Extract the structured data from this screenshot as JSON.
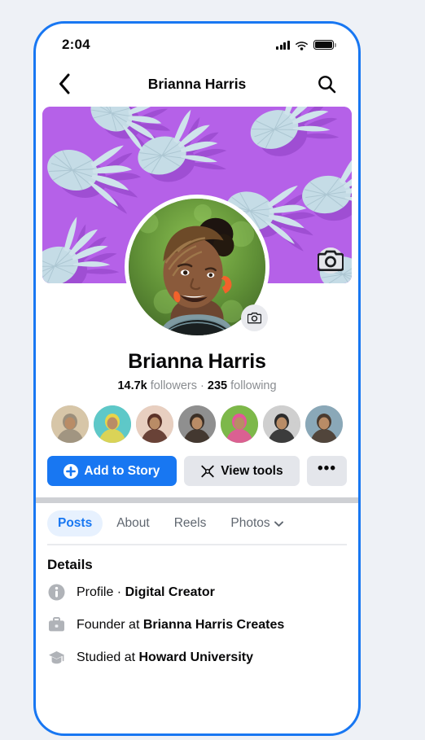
{
  "status_bar": {
    "time": "2:04",
    "icons": [
      "cellular-signal-icon",
      "wifi-icon",
      "battery-icon"
    ]
  },
  "nav": {
    "back_icon": "chevron-left-icon",
    "title": "Brianna Harris",
    "search_icon": "search-icon"
  },
  "cover": {
    "description": "purple background with light blue pineapples",
    "bg_color": "#b561e8",
    "pineapple_color": "#c5dce6",
    "camera_button_label": "camera-icon"
  },
  "profile_picture": {
    "description": "smiling woman with braided updo hair and orange earrings outdoors",
    "camera_button_label": "camera-icon"
  },
  "identity": {
    "name": "Brianna Harris",
    "followers_count": "14.7k",
    "followers_label": "followers",
    "separator": "·",
    "following_count": "235",
    "following_label": "following"
  },
  "friends": [
    {
      "name": "friend-avatar-1",
      "color_a": "#d7c6a8",
      "color_b": "#9b8f7c"
    },
    {
      "name": "friend-avatar-2",
      "color_a": "#5ec8c8",
      "color_b": "#e8d44a"
    },
    {
      "name": "friend-avatar-3",
      "color_a": "#e8cfc0",
      "color_b": "#5b3228"
    },
    {
      "name": "friend-avatar-4",
      "color_a": "#8f8f8f",
      "color_b": "#3b2f26"
    },
    {
      "name": "friend-avatar-5",
      "color_a": "#7db84a",
      "color_b": "#e5569a"
    },
    {
      "name": "friend-avatar-6",
      "color_a": "#cfcfcf",
      "color_b": "#2b2b2b"
    },
    {
      "name": "friend-avatar-7",
      "color_a": "#8aa8b8",
      "color_b": "#4a3a2e"
    }
  ],
  "actions": {
    "add_story": {
      "label": "Add to Story",
      "icon": "plus-circle-icon",
      "bg": "#1877f2",
      "fg": "#ffffff"
    },
    "view_tools": {
      "label": "View tools",
      "icon": "tools-icon",
      "bg": "#e4e6eb",
      "fg": "#080809"
    },
    "more": {
      "label": "•••",
      "icon": "ellipsis-icon"
    }
  },
  "tabs": [
    {
      "label": "Posts",
      "active": true,
      "has_chevron": false
    },
    {
      "label": "About",
      "active": false,
      "has_chevron": false
    },
    {
      "label": "Reels",
      "active": false,
      "has_chevron": false
    },
    {
      "label": "Photos",
      "active": false,
      "has_chevron": true
    }
  ],
  "details": {
    "title": "Details",
    "items": [
      {
        "icon": "info-icon",
        "prefix": "Profile · ",
        "value": "Digital Creator",
        "prefix_bold": false
      },
      {
        "icon": "briefcase-icon",
        "prefix": "Founder at ",
        "value": "Brianna Harris Creates",
        "prefix_bold": false
      },
      {
        "icon": "graduation-cap-icon",
        "prefix": "Studied at ",
        "value": "Howard University",
        "prefix_bold": false
      }
    ]
  },
  "colors": {
    "accent": "#1877f2",
    "page_bg": "#eef1f6",
    "divider": "#ced0d4",
    "muted_text": "#8a8d91",
    "chip_bg": "#e4e6eb",
    "active_tab_bg": "#e7f1fe"
  }
}
